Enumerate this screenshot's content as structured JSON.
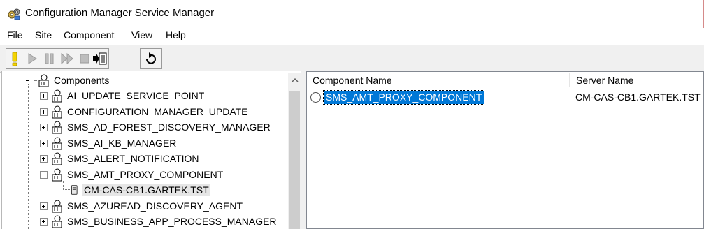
{
  "window": {
    "title": "Configuration Manager Service Manager",
    "icon": "gears-icon"
  },
  "menu": [
    {
      "label": "File"
    },
    {
      "label": "Site"
    },
    {
      "label": "Component"
    },
    {
      "label": "View"
    },
    {
      "label": "Help"
    }
  ],
  "toolbar": {
    "buttons": [
      {
        "name": "query-button",
        "icon": "exclamation-icon",
        "enabled": true
      },
      {
        "name": "start-button",
        "icon": "play-icon",
        "enabled": false
      },
      {
        "name": "pause-button",
        "icon": "pause-icon",
        "enabled": false
      },
      {
        "name": "resume-button",
        "icon": "fast-forward-icon",
        "enabled": false
      },
      {
        "name": "stop-button",
        "icon": "stop-icon",
        "enabled": false
      },
      {
        "name": "logging-button",
        "icon": "log-document-icon",
        "enabled": true
      },
      {
        "name": "refresh-button",
        "icon": "refresh-icon",
        "enabled": true
      }
    ]
  },
  "tree": {
    "root": {
      "label": "Components",
      "expanded": true
    },
    "items": [
      {
        "label": "AI_UPDATE_SERVICE_POINT",
        "expanded": false
      },
      {
        "label": "CONFIGURATION_MANAGER_UPDATE",
        "expanded": false
      },
      {
        "label": "SMS_AD_FOREST_DISCOVERY_MANAGER",
        "expanded": false
      },
      {
        "label": "SMS_AI_KB_MANAGER",
        "expanded": false
      },
      {
        "label": "SMS_ALERT_NOTIFICATION",
        "expanded": false
      },
      {
        "label": "SMS_AMT_PROXY_COMPONENT",
        "expanded": true
      },
      {
        "label": "CM-CAS-CB1.GARTEK.TST",
        "server": true,
        "selected": true
      },
      {
        "label": "SMS_AZUREAD_DISCOVERY_AGENT",
        "expanded": false
      },
      {
        "label": "SMS_BUSINESS_APP_PROCESS_MANAGER",
        "expanded": false
      }
    ]
  },
  "list": {
    "columns": [
      "Component Name",
      "Server Name"
    ],
    "rows": [
      {
        "component": "SMS_AMT_PROXY_COMPONENT",
        "server": "CM-CAS-CB1.GARTEK.TST",
        "selected": true
      }
    ]
  },
  "colors": {
    "selection": "#0078d7",
    "toolbar_bg": "#f0f0f0",
    "query_yellow": "#f4d400"
  }
}
